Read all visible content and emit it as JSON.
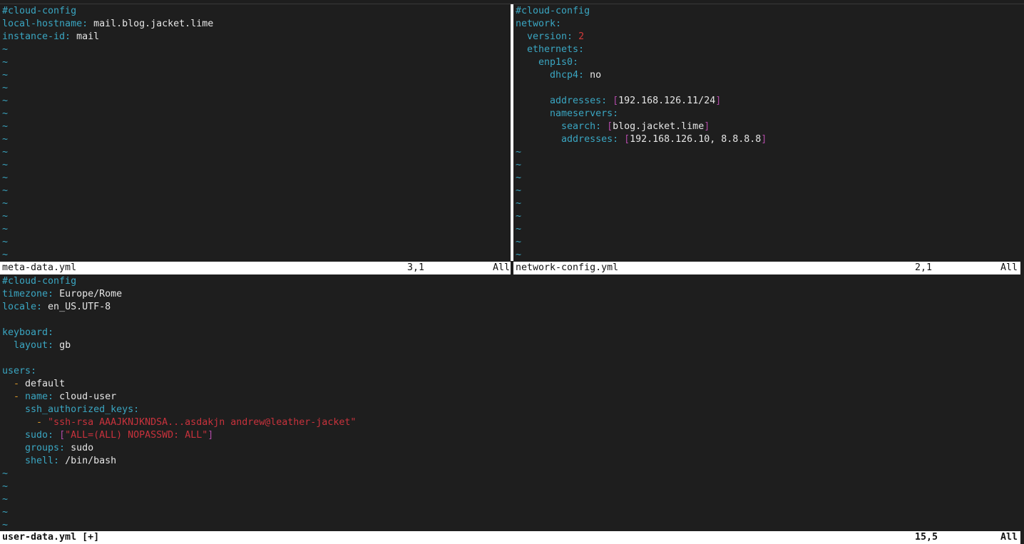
{
  "colors": {
    "background": "#1e1e1e",
    "key": "#3aa6c2",
    "number": "#d23a3a",
    "string": "#c8323c",
    "bracket": "#b04aa6",
    "dash": "#d9982a",
    "statusbar": "#ffffff"
  },
  "panes": {
    "meta": {
      "lines": [
        [
          {
            "t": "#cloud-config",
            "c": "c"
          }
        ],
        [
          {
            "t": "local-hostname:",
            "c": "k"
          },
          {
            "t": " mail.blog.jacket.lime",
            "c": "v"
          }
        ],
        [
          {
            "t": "instance-id:",
            "c": "k"
          },
          {
            "t": " mail",
            "c": "v"
          }
        ]
      ],
      "tildes": 17,
      "status": {
        "file": "meta-data.yml",
        "pos": "3,1",
        "scroll": "All"
      }
    },
    "network": {
      "lines": [
        [
          {
            "t": "#cloud-config",
            "c": "c"
          }
        ],
        [
          {
            "t": "network:",
            "c": "k"
          }
        ],
        [
          {
            "t": "  version:",
            "c": "k"
          },
          {
            "t": " 2",
            "c": "n"
          }
        ],
        [
          {
            "t": "  ethernets:",
            "c": "k"
          }
        ],
        [
          {
            "t": "    enp1s0:",
            "c": "k"
          }
        ],
        [
          {
            "t": "      dhcp4:",
            "c": "k"
          },
          {
            "t": " no",
            "c": "v"
          }
        ],
        [],
        [
          {
            "t": "      addresses:",
            "c": "k"
          },
          {
            "t": " [",
            "c": "b"
          },
          {
            "t": "192.168.126.11/24",
            "c": "v"
          },
          {
            "t": "]",
            "c": "b"
          }
        ],
        [
          {
            "t": "      nameservers:",
            "c": "k"
          }
        ],
        [
          {
            "t": "        search:",
            "c": "k"
          },
          {
            "t": " [",
            "c": "b"
          },
          {
            "t": "blog.jacket.lime",
            "c": "v"
          },
          {
            "t": "]",
            "c": "b"
          }
        ],
        [
          {
            "t": "        addresses:",
            "c": "k"
          },
          {
            "t": " [",
            "c": "b"
          },
          {
            "t": "192.168.126.10, 8.8.8.8",
            "c": "v"
          },
          {
            "t": "]",
            "c": "b"
          }
        ]
      ],
      "tildes": 9,
      "status": {
        "file": "network-config.yml",
        "pos": "2,1",
        "scroll": "All"
      }
    },
    "user": {
      "lines": [
        [
          {
            "t": "#cloud-config",
            "c": "c"
          }
        ],
        [
          {
            "t": "timezone:",
            "c": "k"
          },
          {
            "t": " Europe/Rome",
            "c": "v"
          }
        ],
        [
          {
            "t": "locale:",
            "c": "k"
          },
          {
            "t": " en_US.UTF-8",
            "c": "v"
          }
        ],
        [],
        [
          {
            "t": "keyboard:",
            "c": "k"
          }
        ],
        [
          {
            "t": "  layout:",
            "c": "k"
          },
          {
            "t": " gb",
            "c": "v"
          }
        ],
        [],
        [
          {
            "t": "users:",
            "c": "k"
          }
        ],
        [
          {
            "t": "  -",
            "c": "d"
          },
          {
            "t": " default",
            "c": "v"
          }
        ],
        [
          {
            "t": "  -",
            "c": "d"
          },
          {
            "t": " name:",
            "c": "k"
          },
          {
            "t": " cloud-user",
            "c": "v"
          }
        ],
        [
          {
            "t": "    ssh_authorized_keys:",
            "c": "k"
          }
        ],
        [
          {
            "t": "      -",
            "c": "d"
          },
          {
            "t": " \"ssh-rsa AAAJKNJKNDSA...asdakjn andrew@leather-jacket\"",
            "c": "s"
          }
        ],
        [
          {
            "t": "    sudo:",
            "c": "k"
          },
          {
            "t": " [",
            "c": "b"
          },
          {
            "t": "\"ALL=(ALL) NOPASSWD: ALL\"",
            "c": "s"
          },
          {
            "t": "]",
            "c": "b"
          }
        ],
        [
          {
            "t": "    groups:",
            "c": "k"
          },
          {
            "t": " sudo",
            "c": "v"
          }
        ],
        [
          {
            "t": "    shell:",
            "c": "k"
          },
          {
            "t": " /bin/bash",
            "c": "v"
          }
        ]
      ],
      "tildes": 5,
      "status": {
        "file": "user-data.yml [+]",
        "pos": "15,5",
        "scroll": "All"
      }
    }
  },
  "tilde_char": "~"
}
